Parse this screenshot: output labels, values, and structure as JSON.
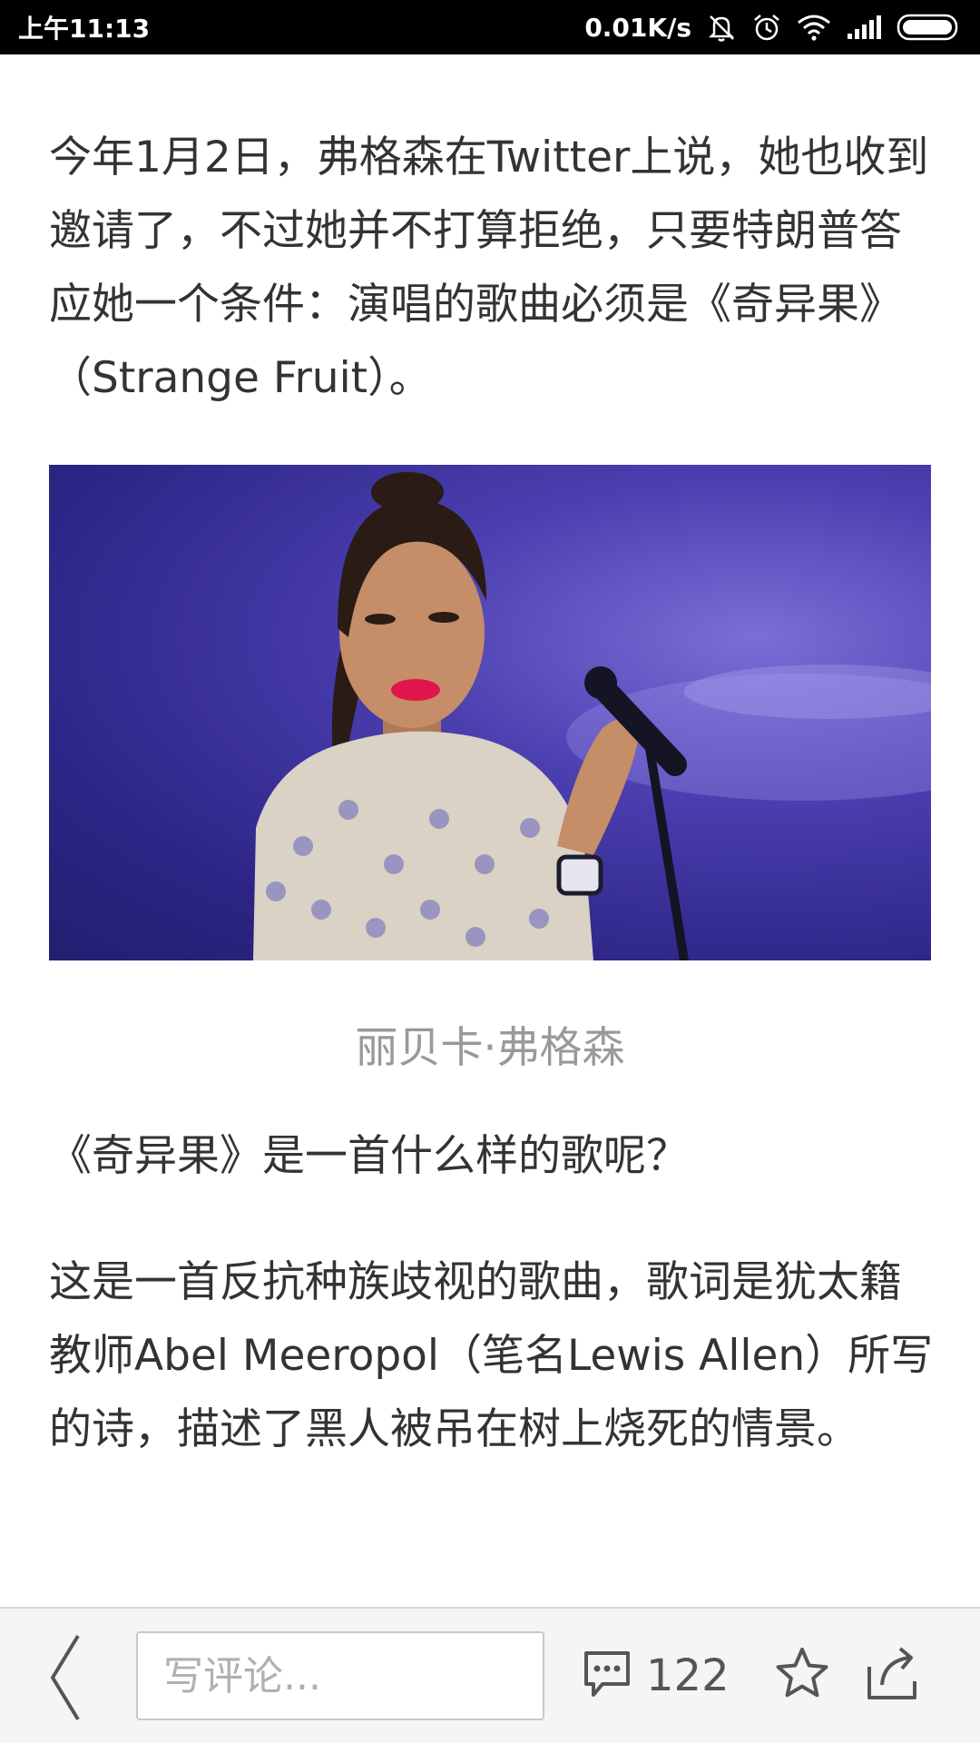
{
  "status_bar": {
    "time": "上午11:13",
    "network_speed": "0.01K/s"
  },
  "article": {
    "paragraph_1": "今年1月2日，弗格森在Twitter上说，她也收到邀请了，不过她并不打算拒绝，只要特朗普答应她一个条件：演唱的歌曲必须是《奇异果》（Strange Fruit）。",
    "image_caption": "丽贝卡·弗格森",
    "paragraph_2": "《奇异果》是一首什么样的歌呢？",
    "paragraph_3": "这是一首反抗种族歧视的歌曲，歌词是犹太籍教师Abel Meeropol（笔名Lewis Allen）所写的诗，描述了黑人被吊在树上烧死的情景。"
  },
  "bottom_bar": {
    "comment_placeholder": "写评论...",
    "comment_count": "122"
  },
  "icons": {
    "status": [
      "mute-icon",
      "alarm-icon",
      "wifi-icon",
      "signal-icon",
      "battery-icon"
    ],
    "bottom": [
      "back-icon",
      "comment-icon",
      "star-icon",
      "share-icon"
    ]
  }
}
